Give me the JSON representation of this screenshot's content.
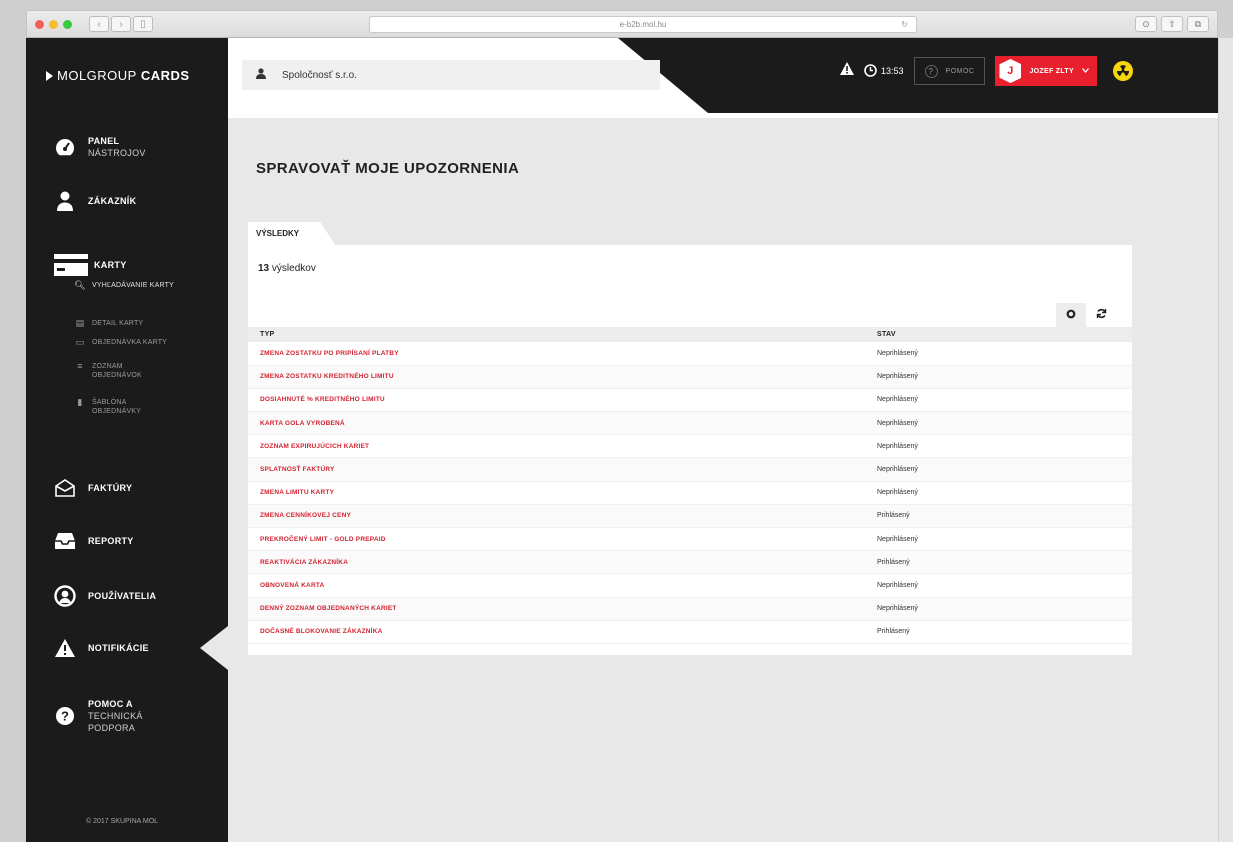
{
  "browser": {
    "url": "e-b2b.mol.hu"
  },
  "sidebar": {
    "brand_light": "MOLGROUP",
    "brand_bold": "CARDS",
    "items": [
      {
        "label": "PANEL",
        "sub": "NÁSTROJOV"
      },
      {
        "label": "ZÁKAZNÍK"
      },
      {
        "label": "KARTY"
      },
      {
        "label": "FAKTÚRY"
      },
      {
        "label": "REPORTY"
      },
      {
        "label": "POUŽÍVATELIA"
      },
      {
        "label": "NOTIFIKÁCIE"
      },
      {
        "label": "POMOC A",
        "sub": "TECHNICKÁ PODPORA"
      }
    ],
    "sub_items": [
      {
        "label": "VYHĽADÁVANIE KARTY"
      },
      {
        "label": "DETAIL KARTY"
      },
      {
        "label": "OBJEDNÁVKA KARTY"
      },
      {
        "label": "ZOZNAM OBJEDNÁVOK"
      },
      {
        "label": "ŠABLÓNA OBJEDNÁVKY"
      }
    ],
    "copyright": "© 2017 SKUPINA MOL"
  },
  "topbar": {
    "company": "Spoločnosť s.r.o.",
    "time": "13:53",
    "help_label": "POMOC",
    "user_initial": "J",
    "user_name": "JOZEF ZLTY"
  },
  "main": {
    "title": "SPRAVOVAŤ MOJE UPOZORNENIA",
    "results_tab": "VÝSLEDKY",
    "count_number": "13",
    "count_label": "výsledkov",
    "columns": {
      "typ": "TYP",
      "stav": "STAV"
    },
    "rows": [
      {
        "typ": "ZMENA ZOSTATKU PO PRIPÍSANÍ PLATBY",
        "stav": "Neprihlásený"
      },
      {
        "typ": "ZMENA ZOSTATKU KREDITNÉHO LIMITU",
        "stav": "Neprihlásený"
      },
      {
        "typ": "DOSIAHNUTÉ % KREDITNÉHO LIMITU",
        "stav": "Neprihlásený"
      },
      {
        "typ": "KARTA GOLA VYROBENÁ",
        "stav": "Neprihlásený"
      },
      {
        "typ": "ZOZNAM EXPIRUJÚCICH KARIET",
        "stav": "Neprihlásený"
      },
      {
        "typ": "SPLATNOSŤ FAKTÚRY",
        "stav": "Neprihlásený"
      },
      {
        "typ": "ZMENA LIMITU KARTY",
        "stav": "Neprihlásený"
      },
      {
        "typ": "ZMENA CENNÍKOVEJ CENY",
        "stav": "Prihlásený"
      },
      {
        "typ": "PREKROČENÝ LIMIT - GOLD PREPAID",
        "stav": "Neprihlásený"
      },
      {
        "typ": "REAKTIVÁCIA ZÁKAZNÍKA",
        "stav": "Prihlásený"
      },
      {
        "typ": "OBNOVENÁ KARTA",
        "stav": "Neprihlásený"
      },
      {
        "typ": "DENNÝ ZOZNAM OBJEDNANÝCH KARIET",
        "stav": "Neprihlásený"
      },
      {
        "typ": "DOČASNÉ BLOKOVANIE ZÁKAZNÍKA",
        "stav": "Prihlásený"
      }
    ]
  },
  "colors": {
    "accent": "#e8202d",
    "sidebar": "#1b1b1b",
    "link": "#d22231",
    "warning": "#f6d80a"
  }
}
